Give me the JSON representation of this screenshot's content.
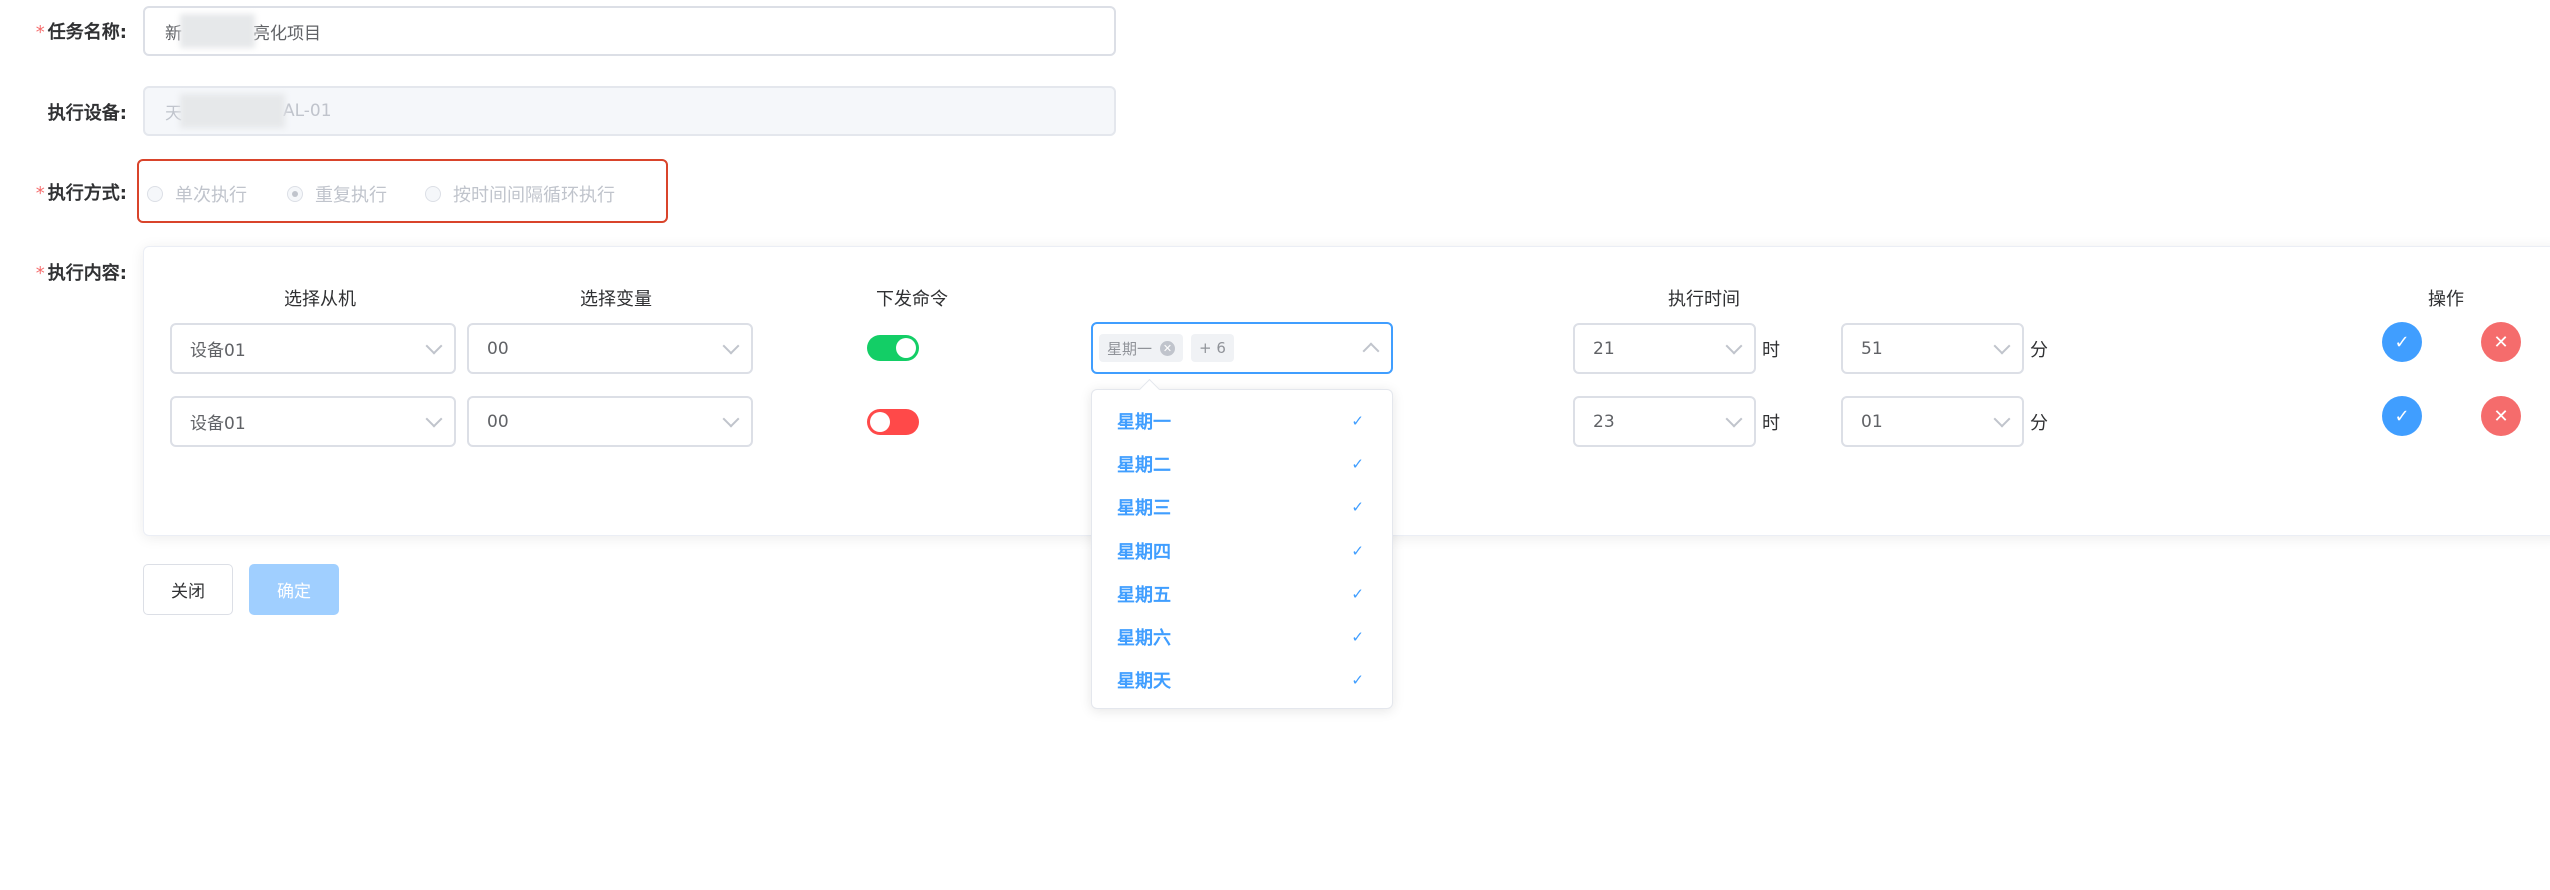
{
  "form": {
    "task_name": {
      "label": "任务名称:",
      "required": "*",
      "value_prefix": "新",
      "value_suffix": "亮化项目"
    },
    "device": {
      "label": "执行设备:",
      "value_prefix": "天",
      "value_suffix": "AL-01"
    },
    "mode": {
      "label": "执行方式:",
      "required": "*",
      "options": [
        "单次执行",
        "重复执行",
        "按时间间隔循环执行"
      ],
      "selected": "重复执行"
    },
    "content": {
      "label": "执行内容:",
      "required": "*"
    }
  },
  "table": {
    "headers": {
      "slave": "选择从机",
      "variable": "选择变量",
      "command": "下发命令",
      "time": "执行时间",
      "action": "操作"
    },
    "rows": [
      {
        "slave": "设备01",
        "variable": "00",
        "command_on": true,
        "days_tag": "星期一",
        "days_more": "+ 6",
        "hour": "21",
        "minute": "51"
      },
      {
        "slave": "设备01",
        "variable": "00",
        "command_on": false,
        "hour": "23",
        "minute": "01"
      }
    ],
    "units": {
      "hour": "时",
      "minute": "分"
    }
  },
  "weekday_dropdown": {
    "options": [
      "星期一",
      "星期二",
      "星期三",
      "星期四",
      "星期五",
      "星期六",
      "星期天"
    ],
    "check_glyph": "✓"
  },
  "buttons": {
    "close": "关闭",
    "confirm": "确定"
  },
  "colors": {
    "primary": "#409eff",
    "danger": "#f56c6c",
    "switch_on": "#13ce66",
    "switch_off": "#ff4949",
    "highlight_border": "#d9442b"
  },
  "icons": {
    "confirm_row": "check-icon",
    "delete_row": "close-icon"
  }
}
